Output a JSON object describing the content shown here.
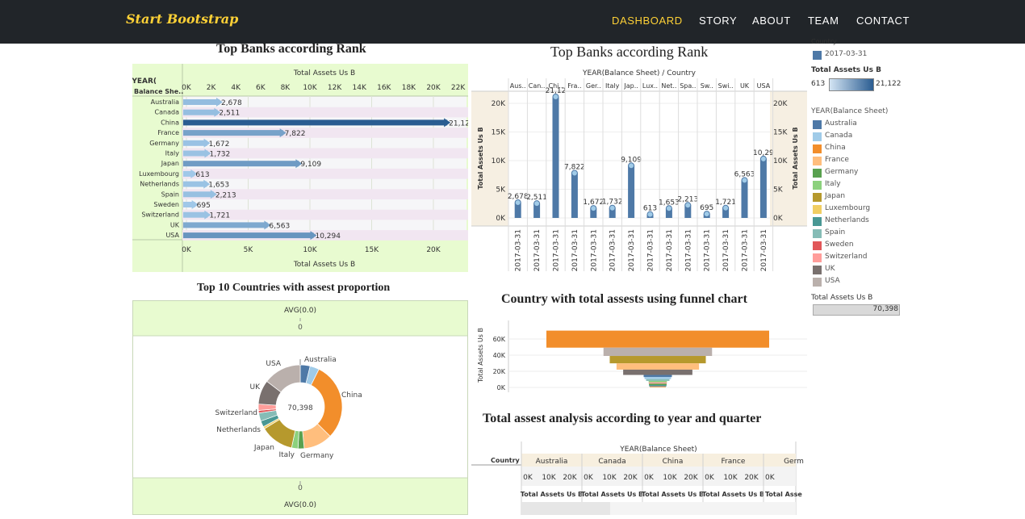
{
  "nav": {
    "brand": "Start Bootstrap",
    "links": [
      "DASHBOARD",
      "STORY",
      "ABOUT",
      "TEAM",
      "CONTACT"
    ],
    "active": 0,
    "brand_color": "#fed136",
    "bg_color": "#212529"
  },
  "titles": {
    "rank_left": "Top Banks according Rank",
    "rank_right": "Top Banks according Rank",
    "donut": "Top 10 Countries with assest proportion",
    "funnel": "Country with total assests using funnel chart",
    "year_quarter": "Total assest analysis according to year and quarter"
  },
  "colors": {
    "Australia": "#4e79a7",
    "Canada": "#a0cbe8",
    "China": "#f28e2b",
    "France": "#ffbe7d",
    "Germany": "#59a14f",
    "Italy": "#8cd17d",
    "Japan": "#b6992d",
    "Luxembourg": "#f1ce63",
    "Netherlands": "#499894",
    "Spain": "#86bcb6",
    "Sweden": "#e15759",
    "Switzerland": "#ff9d9a",
    "UK": "#79706e",
    "USA": "#bab0ac"
  },
  "chart_data": [
    {
      "type": "bar",
      "orientation": "horizontal",
      "title": "Top Banks according Rank",
      "row_header": "YEAR( Balance She..",
      "xlabel": "Total Assets Us B",
      "top_axis_ticks": [
        "0K",
        "2K",
        "4K",
        "6K",
        "8K",
        "10K",
        "12K",
        "14K",
        "16K",
        "18K",
        "20K",
        "22K"
      ],
      "bottom_axis_ticks": [
        "0K",
        "5K",
        "10K",
        "15K",
        "20K"
      ],
      "xlim": [
        0,
        22000
      ],
      "categories": [
        "Australia",
        "Canada",
        "China",
        "France",
        "Germany",
        "Italy",
        "Japan",
        "Luxembourg",
        "Netherlands",
        "Spain",
        "Sweden",
        "Switzerland",
        "UK",
        "USA"
      ],
      "values": [
        2678,
        2511,
        21122,
        7822,
        1672,
        1732,
        9109,
        613,
        1653,
        2213,
        695,
        1721,
        6563,
        10294
      ],
      "labels": [
        "2,678",
        "2,511",
        "21,122",
        "7,822",
        "1,672",
        "1,732",
        "9,109",
        "613",
        "1,653",
        "2,213",
        "695",
        "1,721",
        "6,563",
        "10,294"
      ],
      "label_shown": [
        "2,678",
        "2,511",
        "21,12",
        "7,822",
        "1,672",
        "1,732",
        "9,109",
        "613",
        "1,653",
        "2,213",
        "695",
        "1,721",
        "6,563",
        "10,294"
      ]
    },
    {
      "type": "bar",
      "title": "Top Banks according Rank",
      "header": "YEAR(Balance Sheet) / Country",
      "ylabel": "Total Assets Us B",
      "ylabel_right": "Total Assets Us B",
      "column_labels": [
        "Aus..",
        "Can..",
        "Chi..",
        "Fra..",
        "Ger..",
        "Italy",
        "Jap..",
        "Lux..",
        "Net..",
        "Spa..",
        "Sw..",
        "Swi..",
        "UK",
        "USA"
      ],
      "categories": [
        "Australia",
        "Canada",
        "China",
        "France",
        "Germany",
        "Italy",
        "Japan",
        "Luxembourg",
        "Netherlands",
        "Spain",
        "Sweden",
        "Switzerland",
        "UK",
        "USA"
      ],
      "values": [
        2678,
        2511,
        21122,
        7822,
        1672,
        1732,
        9109,
        613,
        1653,
        2213,
        695,
        1721,
        6563,
        10294
      ],
      "labels": [
        "2,678",
        "2,511",
        "21,12",
        "7,822",
        "1,672",
        "1,732",
        "9,109",
        "613",
        "1,653",
        "2,213",
        "695",
        "1,721",
        "6,563",
        "10,29"
      ],
      "y_ticks": [
        "0K",
        "5K",
        "10K",
        "15K",
        "20K"
      ],
      "ylim": [
        0,
        23500
      ],
      "date_label": "2017-03-31"
    },
    {
      "type": "pie",
      "title": "Top 10 Countries with assest proportion",
      "center_label": "70,398",
      "header_top": "AVG(0.0)",
      "header_top_value": "0",
      "footer_value": "0",
      "footer": "AVG(0.0)",
      "categories": [
        "Australia",
        "Canada",
        "China",
        "France",
        "Germany",
        "Italy",
        "Japan",
        "Luxembourg",
        "Netherlands",
        "Spain",
        "Sweden",
        "Switzerland",
        "UK",
        "USA"
      ],
      "values": [
        2678,
        2511,
        21122,
        7822,
        1672,
        1732,
        9109,
        613,
        1653,
        2213,
        695,
        1721,
        6563,
        10294
      ],
      "labeled": [
        "Australia",
        "China",
        "Germany",
        "Italy",
        "Japan",
        "Netherlands",
        "Switzerland",
        "UK",
        "USA"
      ]
    },
    {
      "type": "bar",
      "subtype": "funnel",
      "title": "Country with total assests using funnel chart",
      "ylabel": "Total Assets Us B",
      "y_ticks": [
        "0K",
        "20K",
        "40K",
        "60K"
      ],
      "categories": [
        "China",
        "USA",
        "Japan",
        "France",
        "UK",
        "Australia",
        "Canada",
        "Spain",
        "Italy",
        "Switzerland",
        "Germany",
        "Netherlands",
        "Sweden",
        "Luxembourg"
      ],
      "values": [
        21122,
        10294,
        9109,
        7822,
        6563,
        2678,
        2511,
        2213,
        1732,
        1721,
        1672,
        1653,
        695,
        613
      ]
    }
  ],
  "legend": {
    "country_label": "Country",
    "date_item": "2017-03-31",
    "size_title": "Total Assets Us B",
    "size_min": "613",
    "size_max": "21,122",
    "color_title": "YEAR(Balance Sheet)",
    "items": [
      "Australia",
      "Canada",
      "China",
      "France",
      "Germany",
      "Italy",
      "Japan",
      "Luxembourg",
      "Netherlands",
      "Spain",
      "Sweden",
      "Switzerland",
      "UK",
      "USA"
    ],
    "total_title": "Total Assets Us B",
    "total_value": "70,398"
  },
  "year_quarter": {
    "header": "YEAR(Balance Sheet)",
    "row_label": "Country",
    "columns": [
      "Australia",
      "Canada",
      "China",
      "France",
      "Germ"
    ],
    "ticks": [
      "0K",
      "10K",
      "20K"
    ],
    "axis_label": "Total Assets Us B",
    "axis_label_cut": "Total Asse"
  }
}
